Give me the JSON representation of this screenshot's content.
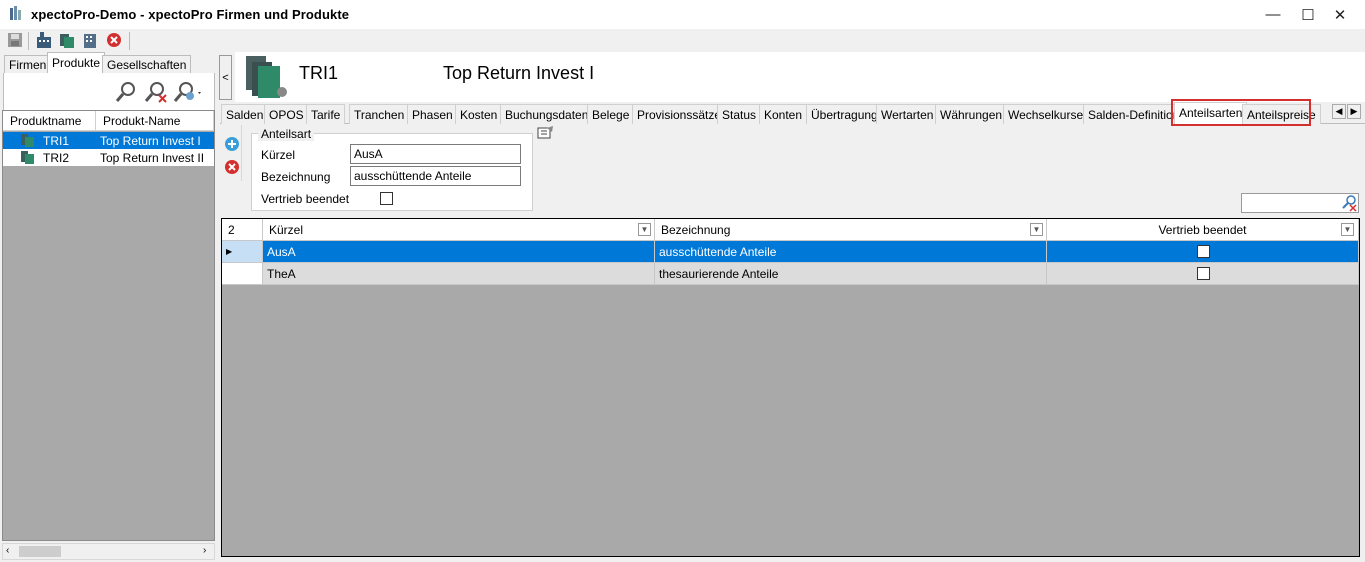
{
  "window": {
    "title": "xpectoPro-Demo - xpectoPro Firmen und Produkte",
    "minimize": "—",
    "maximize": "☐",
    "close": "✕"
  },
  "left_tabs": [
    "Firmen",
    "Produkte",
    "Gesellschaften"
  ],
  "tree": {
    "columns": [
      "Produktname",
      "Produkt-Name"
    ],
    "rows": [
      {
        "name": "TRI1",
        "label": "Top Return Invest I",
        "selected": true
      },
      {
        "name": "TRI2",
        "label": "Top Return Invest II",
        "selected": false
      }
    ]
  },
  "header": {
    "code": "TRI1",
    "name": "Top Return Invest I"
  },
  "splitter_glyph": "<",
  "tabs": [
    "Salden",
    "OPOS",
    "Tarife",
    "Tranchen",
    "Phasen",
    "Kosten",
    "Buchungsdaten",
    "Belege",
    "Provisionssätze",
    "Status",
    "Konten",
    "Übertragung",
    "Wertarten",
    "Währungen",
    "Wechselkurse",
    "Salden-Definition",
    "Anteilsarten",
    "Anteilspreise"
  ],
  "active_tab": "Anteilsarten",
  "form": {
    "group_title": "Anteilsart",
    "kuerzel_label": "Kürzel",
    "kuerzel_value": "AusA",
    "bezeichnung_label": "Bezeichnung",
    "bezeichnung_value": "ausschüttende Anteile",
    "vertrieb_label": "Vertrieb beendet",
    "vertrieb_checked": false
  },
  "grid": {
    "count": "2",
    "columns": [
      "Kürzel",
      "Bezeichnung",
      "Vertrieb beendet"
    ],
    "rows": [
      {
        "kuerzel": "AusA",
        "bezeichnung": "ausschüttende Anteile",
        "vertrieb": false,
        "selected": true,
        "indicator": "▶"
      },
      {
        "kuerzel": "TheA",
        "bezeichnung": "thesaurierende Anteile",
        "vertrieb": false,
        "selected": false,
        "indicator": ""
      }
    ]
  },
  "colors": {
    "selection": "#0078d7",
    "highlight_border": "#d32f2f",
    "grid_background": "#a9a9a9"
  }
}
